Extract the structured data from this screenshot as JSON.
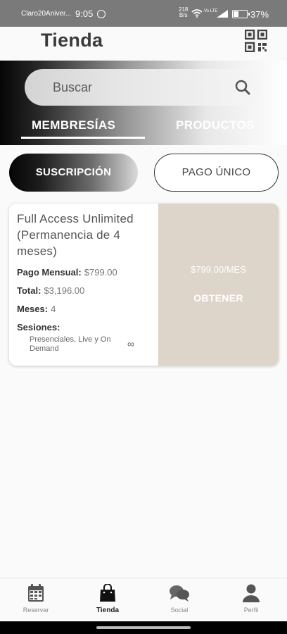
{
  "status_bar": {
    "carrier": "Claro20Aniver...",
    "time": "9:05",
    "net_speed_value": "218",
    "net_speed_unit": "B/s",
    "volte": "Vo LTE",
    "battery_text": "37%",
    "battery_level": 0.37
  },
  "header": {
    "title": "Tienda",
    "qr_icon": "qr-code-icon"
  },
  "search": {
    "placeholder": "Buscar",
    "icon": "search-icon"
  },
  "tabs": [
    {
      "label": "MEMBRESÍAS",
      "active": true
    },
    {
      "label": "PRODUCTOS",
      "active": false
    }
  ],
  "toggle": {
    "subscription_label": "SUSCRIPCIÓN",
    "one_time_label": "PAGO ÚNICO",
    "selected": "subscription"
  },
  "membership_card": {
    "name": "Full Access Unlimited (Permanencia de 4 meses)",
    "monthly_label": "Pago Mensual:",
    "monthly_value": "$799.00",
    "total_label": "Total:",
    "total_value": "$3,196.00",
    "months_label": "Meses:",
    "months_value": "4",
    "sessions_label": "Sesiones:",
    "sessions_value": "Presenciales, Live y On Demand",
    "sessions_count": "∞",
    "price_per_month": "$799.00/MES",
    "cta_label": "OBTENER",
    "accent_color": "#ddd5ca"
  },
  "bottom_nav": [
    {
      "label": "Reservar",
      "icon": "calendar-icon",
      "active": false
    },
    {
      "label": "Tienda",
      "icon": "shopping-bag-icon",
      "active": true
    },
    {
      "label": "Social",
      "icon": "chat-bubbles-icon",
      "active": false
    },
    {
      "label": "Perfil",
      "icon": "user-icon",
      "active": false
    }
  ]
}
